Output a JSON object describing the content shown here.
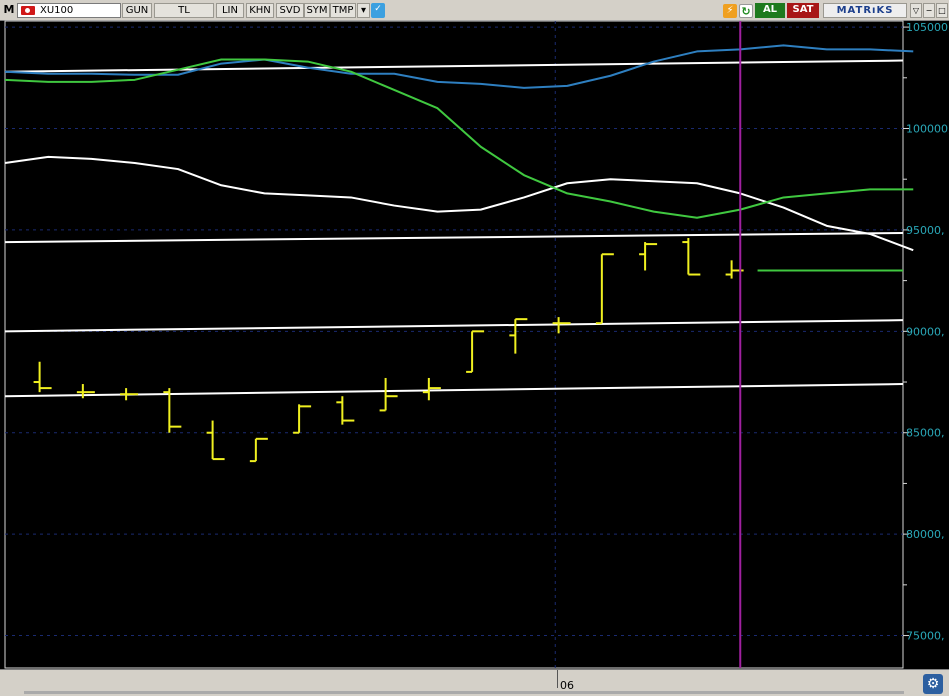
{
  "toolbar": {
    "menu_label": "M",
    "symbol": "XU100",
    "symbol_icon": "flag-icon",
    "period": "GUN",
    "currency": "TL",
    "scale": "LIN",
    "btn_khn": "KHN",
    "btn_svd": "SVD",
    "btn_sym": "SYM",
    "btn_tmp": "TMP",
    "buy_label": "AL",
    "sell_label": "SAT",
    "brand": "MATRıKS",
    "colors": {
      "buy": "#1e7a1e",
      "sell": "#a81616",
      "brand": "#1c3f8c"
    }
  },
  "bottom": {
    "x_tick": "06"
  },
  "chart_data": {
    "type": "ohlc",
    "y_axis": {
      "ticks": [
        75000,
        80000,
        85000,
        90000,
        95000,
        100000,
        105000
      ],
      "tick_labels": [
        "75000,",
        "80000,",
        "85000,",
        "90000,",
        "95000,",
        "100000,",
        "105000,"
      ],
      "ylim": [
        73400,
        105300
      ],
      "side": "right"
    },
    "grid": true,
    "colors": {
      "bars": "#f0f020",
      "upper_band": "#2e7fc0",
      "middle_line": "#40c840",
      "lower_band": "#ffffff",
      "trendline": "#ffffff",
      "cursor": "#a020a0",
      "grid": "#1a2a70",
      "axis_text": "#2aa8b8"
    },
    "ohlc": [
      {
        "i": 1,
        "o": 87500,
        "h": 88500,
        "l": 87000,
        "c": 87200
      },
      {
        "i": 2,
        "o": 87000,
        "h": 87400,
        "l": 86700,
        "c": 87000
      },
      {
        "i": 3,
        "o": 86900,
        "h": 87200,
        "l": 86600,
        "c": 86900
      },
      {
        "i": 4,
        "o": 87000,
        "h": 87200,
        "l": 85000,
        "c": 85300
      },
      {
        "i": 5,
        "o": 85000,
        "h": 85600,
        "l": 83700,
        "c": 83700
      },
      {
        "i": 6,
        "o": 83600,
        "h": 84700,
        "l": 83600,
        "c": 84700
      },
      {
        "i": 7,
        "o": 85000,
        "h": 86400,
        "l": 85000,
        "c": 86300
      },
      {
        "i": 8,
        "o": 86500,
        "h": 86800,
        "l": 85400,
        "c": 85600
      },
      {
        "i": 9,
        "o": 86100,
        "h": 87700,
        "l": 86100,
        "c": 86800
      },
      {
        "i": 10,
        "o": 87000,
        "h": 87700,
        "l": 86600,
        "c": 87200
      },
      {
        "i": 11,
        "o": 88000,
        "h": 90000,
        "l": 88000,
        "c": 90000
      },
      {
        "i": 12,
        "o": 89800,
        "h": 90600,
        "l": 88900,
        "c": 90600
      },
      {
        "i": 13,
        "o": 90400,
        "h": 90700,
        "l": 89900,
        "c": 90400
      },
      {
        "i": 14,
        "o": 90400,
        "h": 93800,
        "l": 90400,
        "c": 93800
      },
      {
        "i": 15,
        "o": 93800,
        "h": 94400,
        "l": 93000,
        "c": 94300
      },
      {
        "i": 16,
        "o": 94400,
        "h": 94600,
        "l": 92800,
        "c": 92800
      },
      {
        "i": 17,
        "o": 92800,
        "h": 93500,
        "l": 92600,
        "c": 93000
      }
    ],
    "bar_x_index_scale": {
      "first_index": 1,
      "index_step": 1
    },
    "upper_band": [
      102800,
      102700,
      102700,
      102650,
      102650,
      103200,
      103400,
      103000,
      102700,
      102700,
      102300,
      102200,
      102000,
      102100,
      102600,
      103300,
      103800,
      103900,
      104100,
      103900,
      103900,
      103800
    ],
    "middle_line": [
      102400,
      102300,
      102300,
      102400,
      102900,
      103400,
      103400,
      103300,
      102800,
      101900,
      101000,
      99100,
      97700,
      96800,
      96400,
      95900,
      95600,
      96000,
      96600,
      96800,
      97000,
      97000
    ],
    "lower_band": [
      98300,
      98600,
      98500,
      98300,
      98000,
      97200,
      96800,
      96700,
      96600,
      96200,
      95900,
      96000,
      96600,
      97300,
      97500,
      97400,
      97300,
      96800,
      96100,
      95200,
      94800,
      94000
    ],
    "band_x": [
      0,
      1,
      2,
      3,
      4,
      5,
      6,
      7,
      8,
      9,
      10,
      11,
      12,
      13,
      14,
      15,
      16,
      17,
      18,
      19,
      20,
      21
    ],
    "middle_forward": {
      "from": 17.4,
      "to": 21,
      "value": 93000
    },
    "trendlines": [
      {
        "x0": 0,
        "y0": 94400,
        "x1": 21,
        "y1": 94850
      },
      {
        "x0": 0,
        "y0": 90000,
        "x1": 21,
        "y1": 90550
      },
      {
        "x0": 0,
        "y0": 86800,
        "x1": 21,
        "y1": 87400
      },
      {
        "x0": 0,
        "y0": 102800,
        "x1": 21,
        "y1": 103350
      }
    ],
    "cursor_x": 17,
    "x_tick_index": 13
  }
}
